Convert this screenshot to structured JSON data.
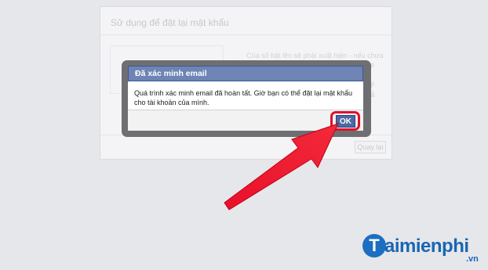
{
  "background_page": {
    "title": "Sử dụng để đặt lại mật khẩu",
    "lines": [
      "Của số bật lên sẽ phải xuất hiện - nếu chưa",
      "le",
      "gi",
      "tắ"
    ],
    "back_label": "Quay lại"
  },
  "dialog": {
    "title": "Đã xác minh email",
    "message": "Quá trình xác minh email đã hoàn tất. Giờ bạn có thể đặt lại mật khẩu cho tài khoản của mình.",
    "ok_label": "OK"
  },
  "logo": {
    "mark": "T",
    "text": "aimienphi",
    "suffix": ".vn"
  },
  "colors": {
    "dialog_header": "#6d84b4",
    "ok_button": "#4e69a2",
    "highlight": "#e0102a",
    "logo": "#1a66b3"
  }
}
